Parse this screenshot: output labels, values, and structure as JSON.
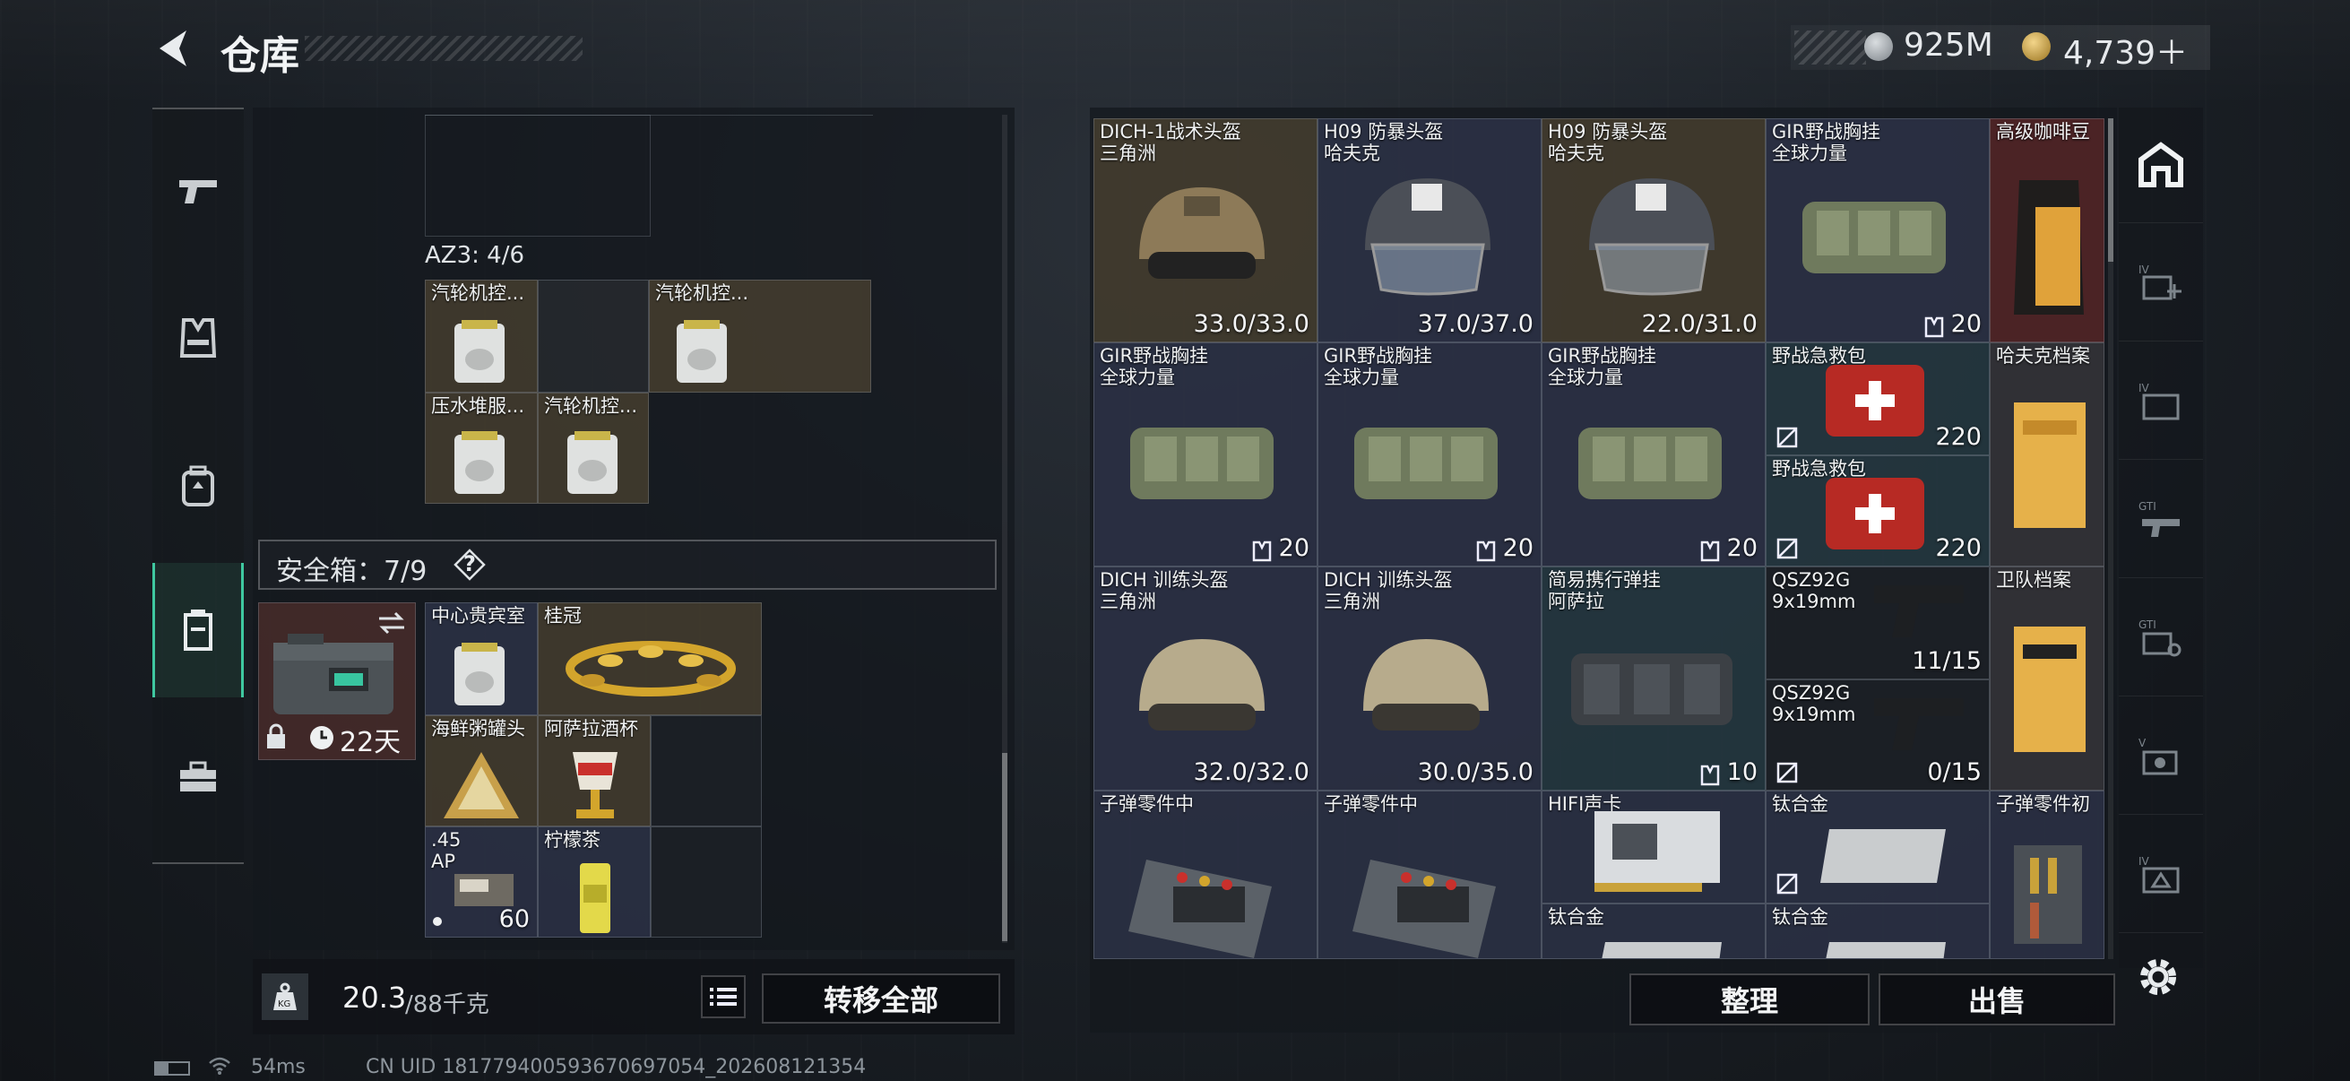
{
  "header": {
    "title": "仓库",
    "currency_silver": "925M",
    "currency_gold": "4,739＋"
  },
  "left_nav": {
    "items": [
      "weapon",
      "chest-rig",
      "backpack",
      "safebox",
      "toolbox"
    ],
    "active": 3
  },
  "inventory": {
    "az3_label": "AZ3: 4/6",
    "az3_items": [
      {
        "name": "汽轮机控..."
      },
      {
        "name": "汽轮机控..."
      },
      {
        "name": "压水堆服..."
      },
      {
        "name": "汽轮机控..."
      }
    ],
    "safe_box_label": "安全箱：7/9",
    "safe_box_help": "?",
    "safe_box_days": "22天",
    "safe_items": [
      {
        "name": "中心贵宾室"
      },
      {
        "name": "桂冠"
      },
      {
        "name": "海鲜粥罐头"
      },
      {
        "name": "阿萨拉酒杯"
      },
      {
        "name": ".45",
        "sub": "AP",
        "value": "60"
      },
      {
        "name": "柠檬茶"
      }
    ],
    "weight_current": "20.3",
    "weight_max": "/88千克",
    "transfer_all_label": "转移全部"
  },
  "warehouse": {
    "items": [
      {
        "name": "DICH-1战术头盔",
        "sub": "三角洲",
        "value": "33.0/33.0"
      },
      {
        "name": "H09 防暴头盔",
        "sub": "哈夫克",
        "value": "37.0/37.0"
      },
      {
        "name": "H09 防暴头盔",
        "sub": "哈夫克",
        "value": "22.0/31.0"
      },
      {
        "name": "GIR野战胸挂",
        "sub": "全球力量",
        "value": "20"
      },
      {
        "name": "高级咖啡豆"
      },
      {
        "name": "GIR野战胸挂",
        "sub": "全球力量",
        "value": "20"
      },
      {
        "name": "GIR野战胸挂",
        "sub": "全球力量",
        "value": "20"
      },
      {
        "name": "GIR野战胸挂",
        "sub": "全球力量",
        "value": "20"
      },
      {
        "name": "野战急救包",
        "value": "220"
      },
      {
        "name": "哈夫克档案"
      },
      {
        "name": "野战急救包",
        "value": "220"
      },
      {
        "name": "DICH 训练头盔",
        "sub": "三角洲",
        "value": "32.0/32.0"
      },
      {
        "name": "DICH 训练头盔",
        "sub": "三角洲",
        "value": "30.0/35.0"
      },
      {
        "name": "简易携行弹挂",
        "sub": "阿萨拉",
        "value": "10"
      },
      {
        "name": "QSZ92G",
        "sub": "9x19mm",
        "value": "11/15"
      },
      {
        "name": "卫队档案"
      },
      {
        "name": "QSZ92G",
        "sub": "9x19mm",
        "value": "0/15"
      },
      {
        "name": "子弹零件中"
      },
      {
        "name": "子弹零件中"
      },
      {
        "name": "HIFI声卡"
      },
      {
        "name": "钛合金"
      },
      {
        "name": "子弹零件初"
      },
      {
        "name": "钛合金"
      },
      {
        "name": "钛合金"
      }
    ],
    "sort_label": "整理",
    "sell_label": "出售"
  },
  "status_bar": {
    "ping": "54ms",
    "uid": "CN UID 18177940059367069705​4_202608121354"
  }
}
